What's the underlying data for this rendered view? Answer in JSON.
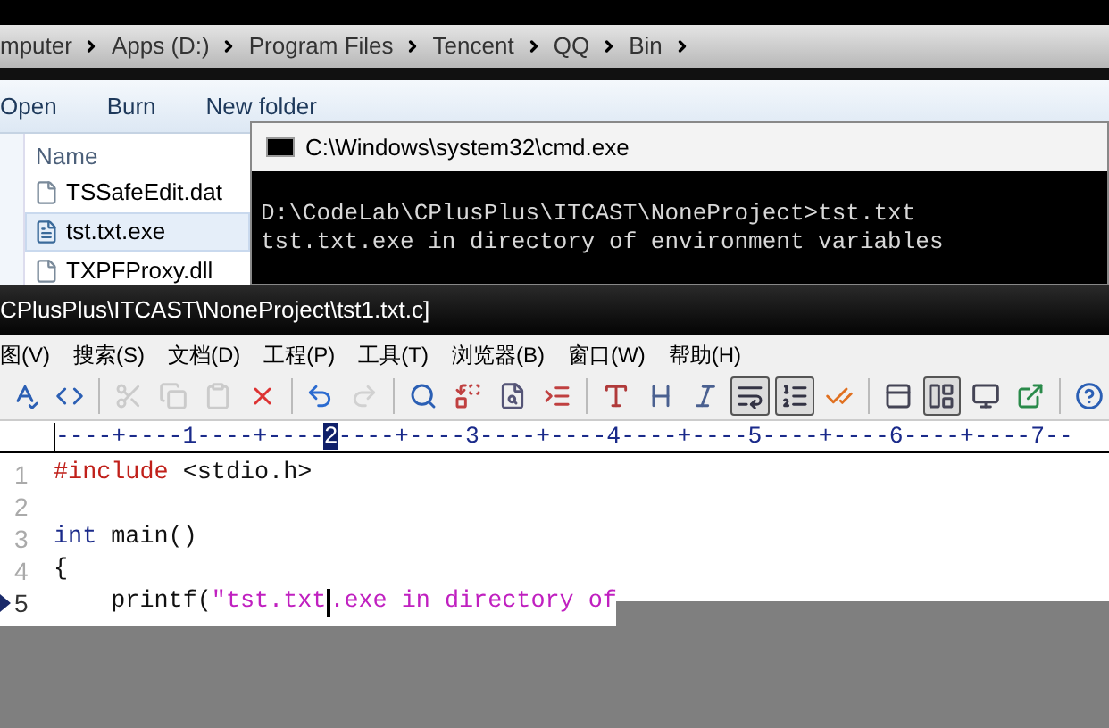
{
  "address_bar": {
    "crumbs": [
      "mputer",
      "Apps (D:)",
      "Program Files",
      "Tencent",
      "QQ",
      "Bin"
    ]
  },
  "explorer_toolbar": [
    "Open",
    "Burn",
    "New folder"
  ],
  "file_list": {
    "column": "Name",
    "files": [
      {
        "name": "TSSafeEdit.dat",
        "selected": false
      },
      {
        "name": "tst.txt.exe",
        "selected": true
      },
      {
        "name": "TXPFProxy.dll",
        "selected": false
      }
    ]
  },
  "console": {
    "title": "C:\\Windows\\system32\\cmd.exe",
    "lines": [
      "D:\\CodeLab\\CPlusPlus\\ITCAST\\NoneProject>tst.txt",
      "tst.txt.exe in directory of environment variables"
    ]
  },
  "editor": {
    "title": "CPlusPlus\\ITCAST\\NoneProject\\tst1.txt.c]",
    "menu": [
      "图(V)",
      "搜索(S)",
      "文档(D)",
      "工程(P)",
      "工具(T)",
      "浏览器(B)",
      "窗口(W)",
      "帮助(H)"
    ],
    "toolbar": [
      {
        "kind": "button",
        "pressed": false,
        "disabled": false
      },
      {
        "kind": "button",
        "pressed": false,
        "disabled": false
      },
      {
        "kind": "separator"
      },
      {
        "kind": "button",
        "pressed": false,
        "disabled": true
      },
      {
        "kind": "button",
        "pressed": false,
        "disabled": true
      },
      {
        "kind": "button",
        "pressed": false,
        "disabled": true
      },
      {
        "kind": "button",
        "pressed": false,
        "disabled": false
      },
      {
        "kind": "separator"
      },
      {
        "kind": "button",
        "pressed": false,
        "disabled": false
      },
      {
        "kind": "button",
        "pressed": false,
        "disabled": true
      },
      {
        "kind": "separator"
      },
      {
        "kind": "button",
        "pressed": false,
        "disabled": false
      },
      {
        "kind": "button",
        "pressed": false,
        "disabled": false
      },
      {
        "kind": "button",
        "pressed": false,
        "disabled": false
      },
      {
        "kind": "button",
        "pressed": false,
        "disabled": false
      },
      {
        "kind": "separator"
      },
      {
        "kind": "button",
        "pressed": false,
        "disabled": false
      },
      {
        "kind": "button",
        "pressed": false,
        "disabled": false
      },
      {
        "kind": "button",
        "pressed": false,
        "disabled": false
      },
      {
        "kind": "button",
        "pressed": true,
        "disabled": false
      },
      {
        "kind": "button",
        "pressed": true,
        "disabled": false
      },
      {
        "kind": "button",
        "pressed": false,
        "disabled": false
      },
      {
        "kind": "separator"
      },
      {
        "kind": "button",
        "pressed": false,
        "disabled": false
      },
      {
        "kind": "button",
        "pressed": true,
        "disabled": false
      },
      {
        "kind": "button",
        "pressed": false,
        "disabled": false
      },
      {
        "kind": "button",
        "pressed": false,
        "disabled": false
      },
      {
        "kind": "separator"
      },
      {
        "kind": "button",
        "pressed": false,
        "disabled": false
      }
    ],
    "ruler": {
      "before": "----+----1----+----",
      "current": "2",
      "after": "----+----3----+----4----+----5----+----6----+----7--"
    },
    "lines": [
      {
        "number": "1",
        "current": false,
        "tokens": [
          {
            "kind": "directive",
            "text": "#include"
          },
          {
            "kind": "plain",
            "text": " <stdio.h>"
          }
        ]
      },
      {
        "number": "2",
        "current": false
      },
      {
        "number": "3",
        "current": false,
        "tokens": [
          {
            "kind": "keyword",
            "text": "int"
          },
          {
            "kind": "plain",
            "text": " main()"
          }
        ]
      },
      {
        "number": "4",
        "current": false,
        "tokens": [
          {
            "kind": "plain",
            "text": "{"
          }
        ]
      },
      {
        "number": "5",
        "current": true,
        "tokens": [
          {
            "kind": "plain",
            "text": "    printf("
          },
          {
            "kind": "string",
            "text": "\"tst.txt"
          },
          {
            "kind": "caret"
          },
          {
            "kind": "string",
            "text": ".exe in directory of"
          }
        ]
      }
    ]
  }
}
